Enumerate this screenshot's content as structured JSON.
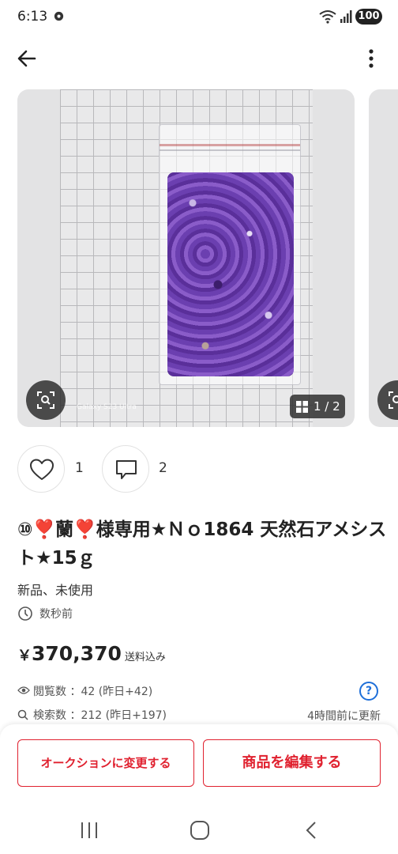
{
  "status_bar": {
    "time": "6:13",
    "battery": "100"
  },
  "gallery": {
    "counter": "1 / 2",
    "watermark": "Galaxy S23 Ultra"
  },
  "actions": {
    "like_count": "1",
    "comment_count": "2"
  },
  "item": {
    "title": "⑩❣️蘭❣️様専用★Ｎｏ1864 天然石アメシスト★15ｇ",
    "condition": "新品、未使用",
    "posted": "数秒前",
    "price_symbol": "￥",
    "price": "370,370",
    "shipping": "送料込み",
    "views": "閲覧数 ：42 (昨日+42)",
    "searches": "検索数 ：212 (昨日+197)",
    "updated": "4時間前に更新",
    "help_label": "?"
  },
  "buttons": {
    "auction": "オークションに変更する",
    "edit": "商品を編集する"
  },
  "colors": {
    "accent": "#e0212f",
    "help": "#1e6fd9"
  }
}
